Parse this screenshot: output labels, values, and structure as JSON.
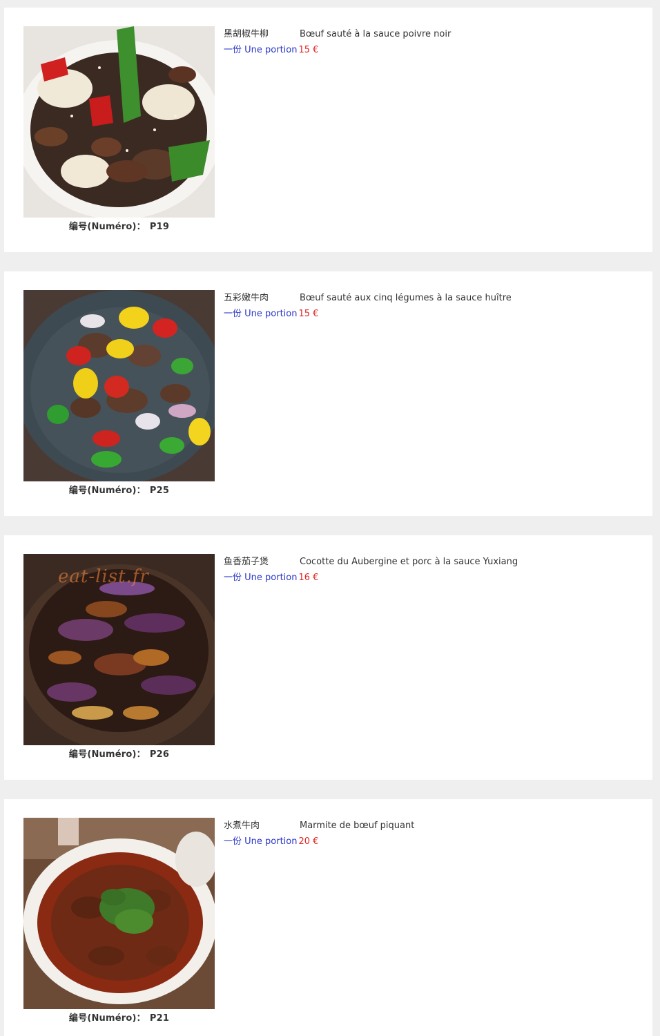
{
  "number_label": "编号(Numéro)：",
  "dishes": [
    {
      "name_cn": "黑胡椒牛柳",
      "name_fr": "Bœuf sauté à la sauce poivre noir",
      "portion_label": "一份 Une portion",
      "price": "15 €",
      "number": "P19"
    },
    {
      "name_cn": "五彩嫩牛肉",
      "name_fr": "Bœuf sauté aux cinq légumes à la sauce huître",
      "portion_label": "一份 Une portion",
      "price": "15 €",
      "number": "P25"
    },
    {
      "name_cn": "鱼香茄子煲",
      "name_fr": "Cocotte du Aubergine et porc à la sauce Yuxiang",
      "portion_label": "一份 Une portion",
      "price": "16 €",
      "number": "P26",
      "watermark": "eat-list.fr"
    },
    {
      "name_cn": "水煮牛肉",
      "name_fr": "Marmite de bœuf piquant",
      "portion_label": "一份 Une portion",
      "price": "20 €",
      "number": "P21"
    }
  ],
  "colors": {
    "background": "#efefef",
    "card": "#ffffff",
    "portion": "#2a36c8",
    "price": "#e02424"
  }
}
